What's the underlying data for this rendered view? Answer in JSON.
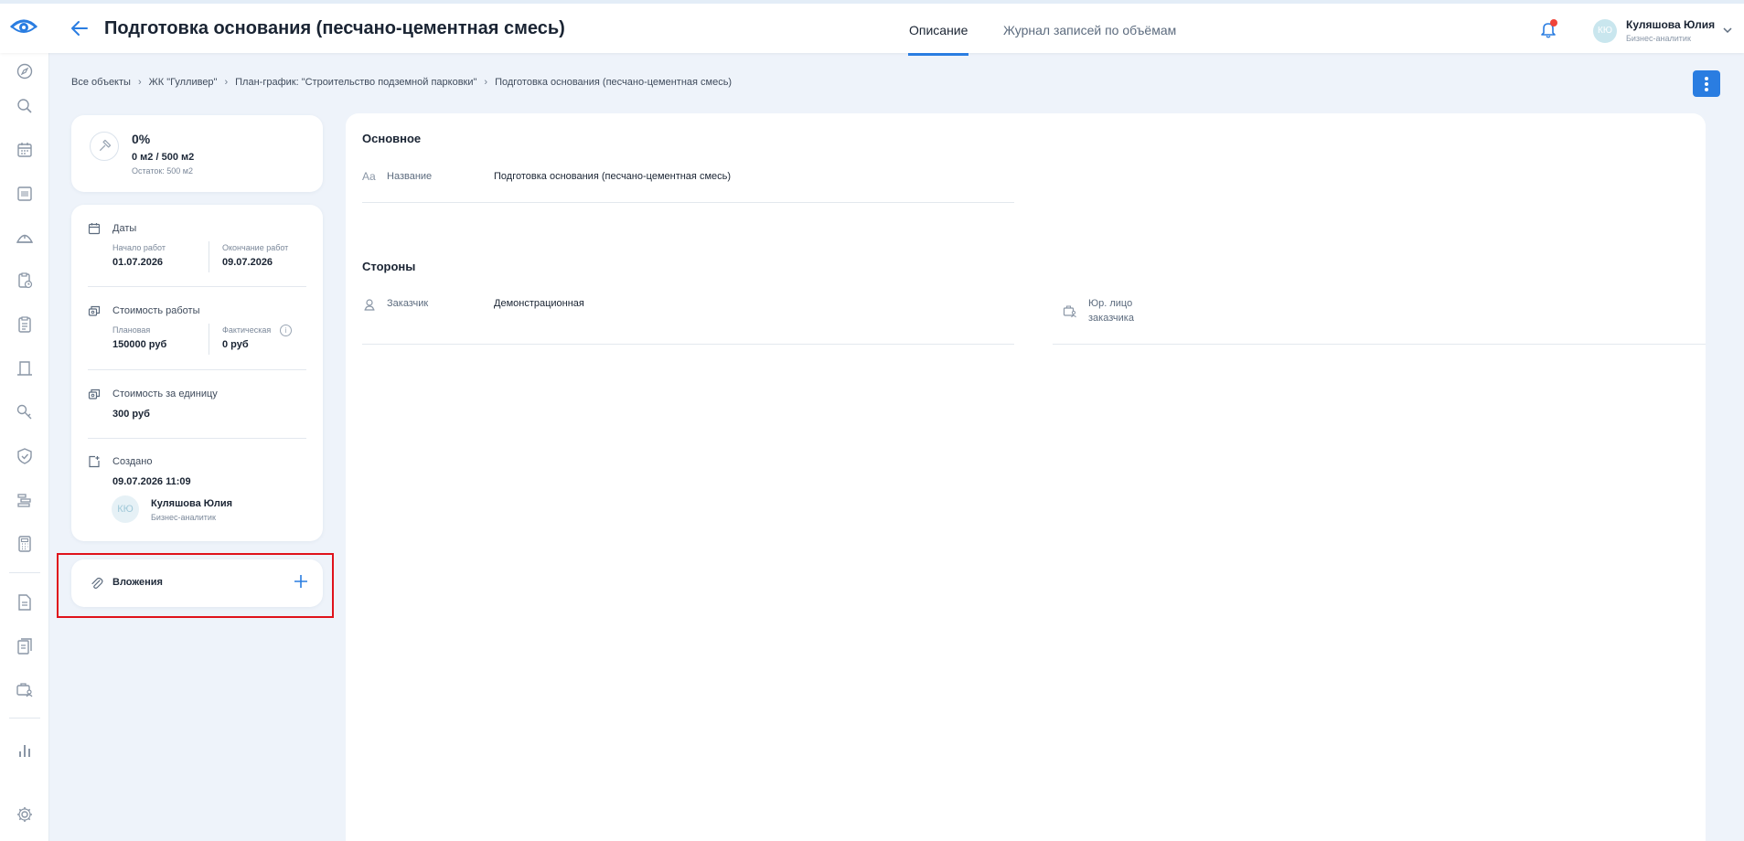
{
  "header": {
    "title": "Подготовка основания (песчано-цементная смесь)",
    "tabs": [
      {
        "label": "Описание",
        "active": true
      },
      {
        "label": "Журнал записей по объёмам",
        "active": false
      }
    ],
    "user": {
      "initials": "КЮ",
      "name": "Куляшова Юлия",
      "role": "Бизнес-аналитик"
    }
  },
  "sidebar": {
    "icons": [
      "compass-icon",
      "search-icon",
      "calendar-icon",
      "document-list-icon",
      "warning-icon",
      "clipboard-clock-icon",
      "clipboard-icon",
      "door-icon",
      "key-icon",
      "shield-check-icon",
      "gantt-icon",
      "calculator-icon",
      "file-icon",
      "files-icon",
      "briefcase-user-icon",
      "bar-chart-icon",
      "settings-icon"
    ]
  },
  "breadcrumb": [
    "Все объекты",
    "ЖК \"Гулливер\"",
    "План-график: \"Строительство подземной парковки\"",
    "Подготовка основания (песчано-цементная смесь)"
  ],
  "progress": {
    "percent": "0%",
    "volume": "0 м2 / 500 м2",
    "remaining": "Остаток: 500 м2",
    "fraction": 0
  },
  "info": {
    "dates": {
      "title": "Даты",
      "start_label": "Начало работ",
      "start_value": "01.07.2026",
      "end_label": "Окончание работ",
      "end_value": "09.07.2026"
    },
    "cost": {
      "title": "Стоимость работы",
      "planned_label": "Плановая",
      "planned_value": "150000 руб",
      "actual_label": "Фактическая",
      "actual_value": "0 руб"
    },
    "unit_cost": {
      "title": "Стоимость за единицу",
      "value": "300 руб"
    },
    "created": {
      "title": "Создано",
      "datetime": "09.07.2026 11:09",
      "author_initials": "КЮ",
      "author_name": "Куляшова Юлия",
      "author_role": "Бизнес-аналитик"
    }
  },
  "attachments": {
    "label": "Вложения"
  },
  "main": {
    "basic": {
      "title": "Основное",
      "name_icon": "Aa",
      "name_label": "Название",
      "name_value": "Подготовка основания (песчано-цементная смесь)"
    },
    "parties": {
      "title": "Стороны",
      "customer_label": "Заказчик",
      "customer_value": "Демонстрационная",
      "legal_label_line1": "Юр. лицо",
      "legal_label_line2": "заказчика"
    }
  },
  "colors": {
    "accent": "#2a7de1",
    "highlight": "#e0121b",
    "background": "#eef3fa",
    "notification": "#f0443a"
  }
}
